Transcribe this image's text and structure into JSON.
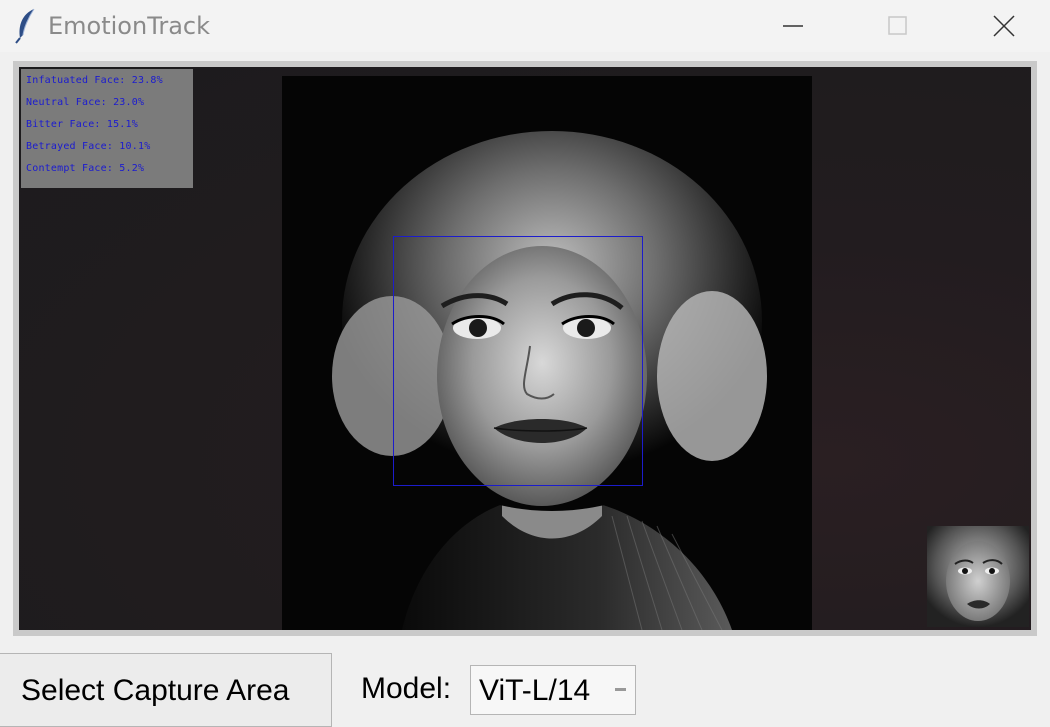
{
  "window": {
    "title": "EmotionTrack",
    "icon": "feather-icon",
    "controls": [
      "minimize-icon",
      "maximize-icon",
      "close-icon"
    ]
  },
  "overlay": {
    "emotions": [
      "Infatuated Face: 23.8%",
      "Neutral Face: 23.0%",
      "Bitter Face: 15.1%",
      "Betrayed Face: 10.1%",
      "Contempt Face: 5.2%"
    ]
  },
  "colors": {
    "overlay_text": "#1b1bd0",
    "face_box": "#1c1ccc",
    "overlay_bg": "#7b7b7b"
  },
  "controls": {
    "select_capture_label": "Select Capture Area",
    "model_label": "Model:",
    "model_value": "ViT-L/14"
  }
}
